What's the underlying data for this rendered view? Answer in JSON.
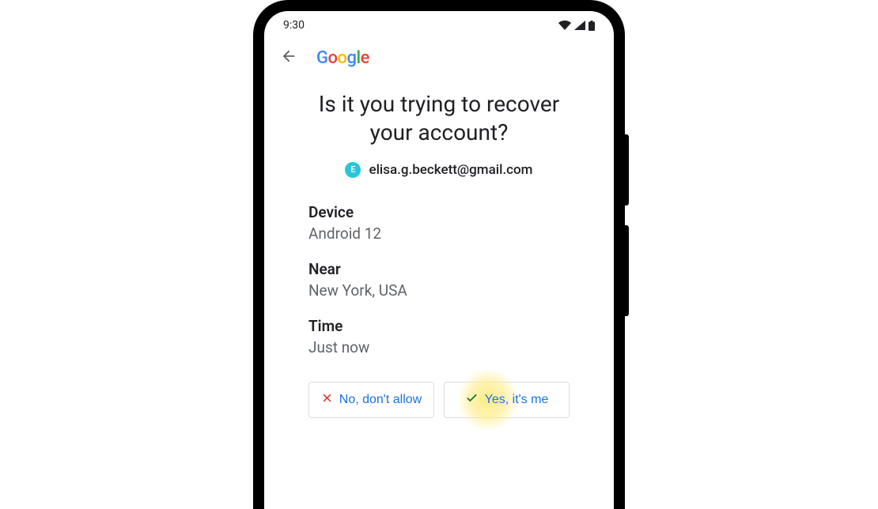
{
  "statusbar": {
    "time": "9:30"
  },
  "header": {
    "logo": {
      "g1": "G",
      "o1": "o",
      "o2": "o",
      "g2": "g",
      "l": "l",
      "e": "e"
    }
  },
  "prompt": {
    "title": "Is it you trying to recover your account?",
    "avatar_initial": "E",
    "email": "elisa.g.beckett@gmail.com"
  },
  "details": {
    "device_label": "Device",
    "device_value": "Android 12",
    "near_label": "Near",
    "near_value": "New York, USA",
    "time_label": "Time",
    "time_value": "Just now"
  },
  "actions": {
    "no_label": "No, don't allow",
    "yes_label": "Yes, it's me"
  }
}
